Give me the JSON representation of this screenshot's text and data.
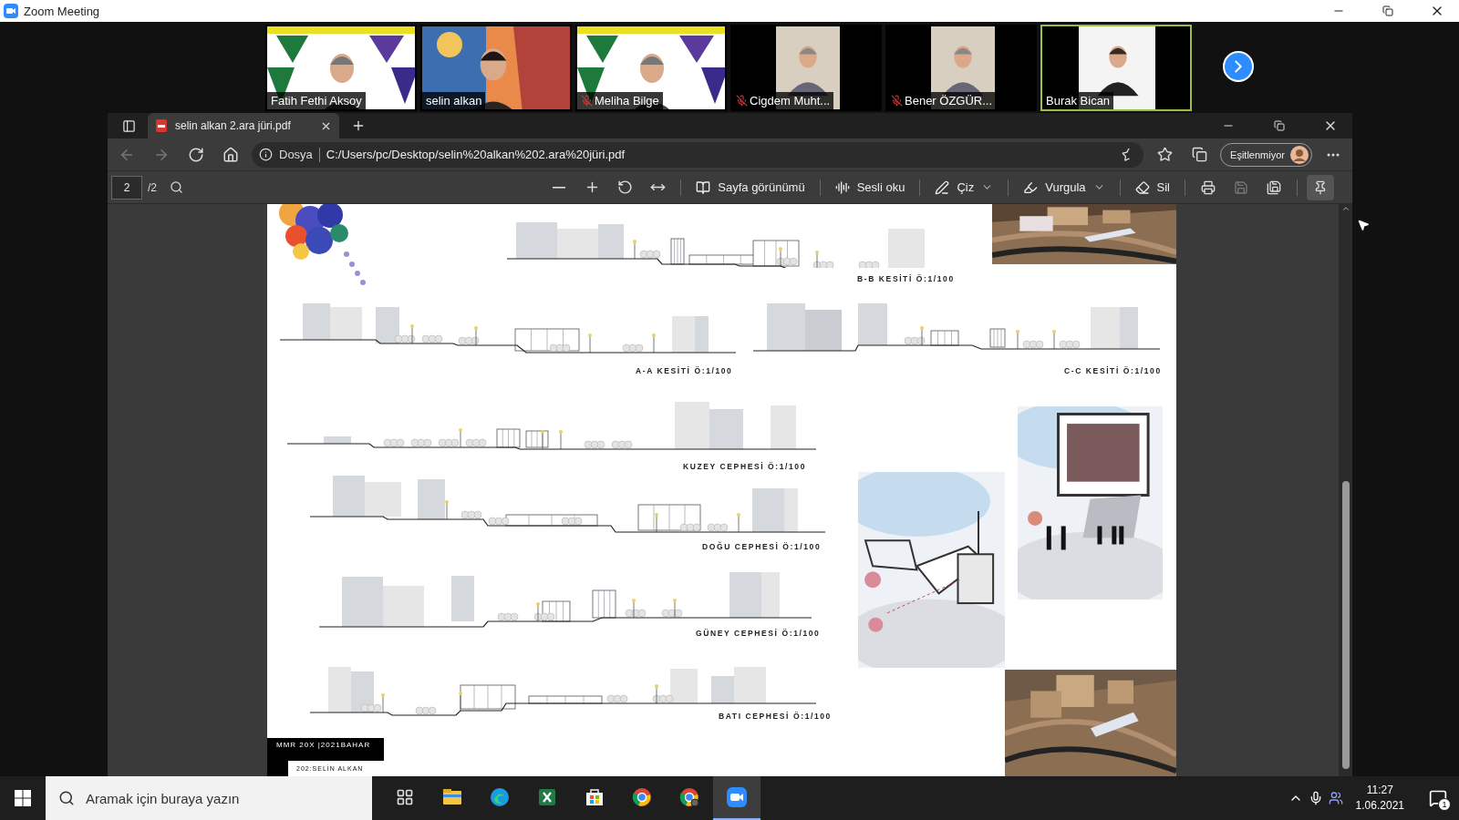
{
  "window": {
    "title": "Zoom Meeting"
  },
  "participants": [
    {
      "name": "Fatih Fethi Aksoy",
      "kind": "poster",
      "muted": false,
      "active_speaker": false
    },
    {
      "name": "selin alkan",
      "kind": "scene",
      "muted": false,
      "active_speaker": false
    },
    {
      "name": "Meliha Bilge",
      "kind": "poster",
      "muted": true,
      "active_speaker": false
    },
    {
      "name": "Cigdem Muht...",
      "kind": "narrow",
      "muted": true,
      "active_speaker": false
    },
    {
      "name": "Bener ÖZGÜR...",
      "kind": "narrow",
      "muted": true,
      "active_speaker": false
    },
    {
      "name": "Burak Bican",
      "kind": "narrow",
      "muted": false,
      "active_speaker": true
    }
  ],
  "browser": {
    "tab": {
      "title": "selin alkan 2.ara jüri.pdf",
      "selected": true
    },
    "nav_buttons": [
      {
        "kind": "back",
        "disabled": true
      },
      {
        "kind": "forward",
        "disabled": true
      },
      {
        "kind": "refresh",
        "disabled": false
      },
      {
        "kind": "home",
        "disabled": false
      }
    ],
    "address": {
      "scheme_label": "Dosya",
      "url": "C:/Users/pc/Desktop/selin%20alkan%202.ara%20jüri.pdf"
    },
    "profile_button": "Eşitlenmiyor"
  },
  "pdf_toolbar": {
    "page": "2",
    "page_count": "/2",
    "view_tools": [
      {
        "kind": "zoom-out",
        "disabled": false
      },
      {
        "kind": "zoom-in",
        "disabled": false
      },
      {
        "kind": "rotate",
        "disabled": false
      },
      {
        "kind": "fit",
        "disabled": false
      }
    ],
    "buttons": [
      {
        "kind": "page-view",
        "label": "Sayfa görünümü",
        "dropdown": false
      },
      {
        "kind": "read-aloud",
        "label": "Sesli oku",
        "dropdown": false
      },
      {
        "kind": "draw",
        "label": "Çiz",
        "dropdown": true
      },
      {
        "kind": "highlight",
        "label": "Vurgula",
        "dropdown": true
      },
      {
        "kind": "erase",
        "label": "Sil",
        "dropdown": false
      }
    ],
    "file_tools": [
      {
        "kind": "print",
        "disabled": false
      },
      {
        "kind": "save",
        "disabled": true
      },
      {
        "kind": "save-as",
        "disabled": false
      }
    ],
    "pinned": true
  },
  "document": {
    "drawings": [
      {
        "label": "B-B KESİTİ Ö:1/100"
      },
      {
        "label": "A-A KESİTİ Ö:1/100"
      },
      {
        "label": "C-C KESİTİ Ö:1/100"
      },
      {
        "label": "KUZEY CEPHESİ Ö:1/100"
      },
      {
        "label": "DOĞU CEPHESİ Ö:1/100"
      },
      {
        "label": "GÜNEY CEPHESİ Ö:1/100"
      },
      {
        "label": "BATI CEPHESİ Ö:1/100"
      }
    ],
    "title_block": {
      "course": "MMR 20X |2021BAHAR",
      "author": "202:SELİN ALKAN"
    }
  },
  "taskbar": {
    "search_placeholder": "Aramak için buraya yazın",
    "apps": [
      {
        "kind": "task-view",
        "selected": false
      },
      {
        "kind": "explorer",
        "selected": false
      },
      {
        "kind": "edge",
        "selected": false
      },
      {
        "kind": "excel",
        "selected": false
      },
      {
        "kind": "store",
        "selected": false
      },
      {
        "kind": "chrome",
        "selected": false
      },
      {
        "kind": "chrome-profile",
        "selected": false
      },
      {
        "kind": "zoom",
        "selected": true
      }
    ],
    "time": "11:27",
    "date": "1.06.2021",
    "notifications": "1"
  }
}
